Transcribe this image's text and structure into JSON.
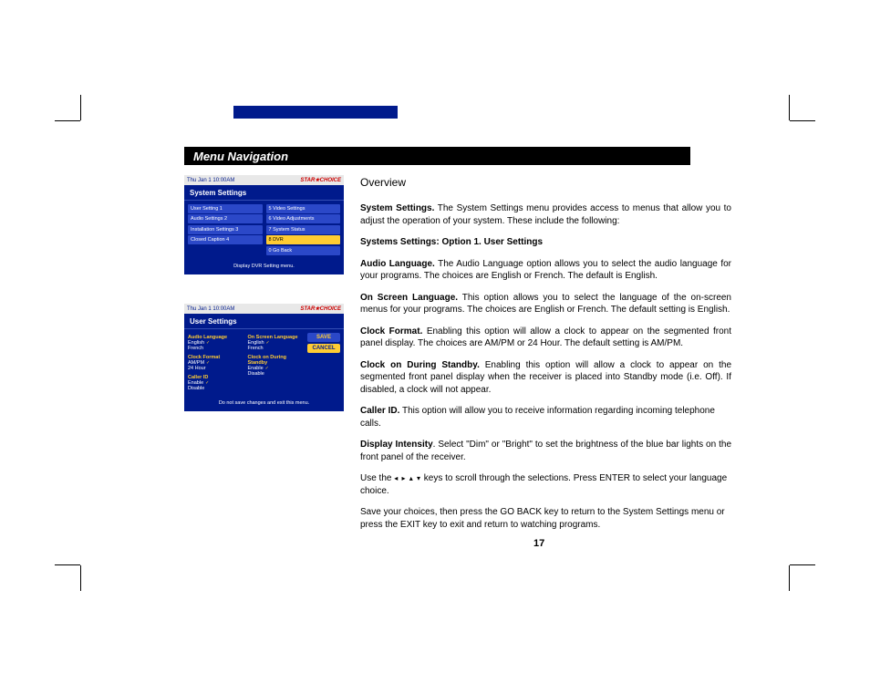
{
  "section_title": "Menu Navigation",
  "overview_heading": "Overview",
  "page_number": "17",
  "body": {
    "p1_bold": "System Settings.",
    "p1": " The System Settings menu provides access to menus that allow you to adjust the operation of your system. These include the following:",
    "p2": "Systems Settings: Option 1. User Settings",
    "p3_bold": "Audio Language.",
    "p3": " The Audio Language option allows you to select the audio language for your programs. The choices are English or French. The default is English.",
    "p4_bold": "On Screen Language.",
    "p4": " This option allows you to select the language of the on-screen menus for your programs. The choices are English or French. The default setting is English.",
    "p5_bold": "Clock Format.",
    "p5": " Enabling this option will allow a clock to appear on the segmented front panel display. The choices are AM/PM or 24 Hour. The default setting is AM/PM.",
    "p6_bold": "Clock on During Standby.",
    "p6": " Enabling this option will allow a clock to appear on the segmented front panel display when the receiver is placed into Standby mode (i.e. Off). If disabled, a clock will not appear.",
    "p7_bold": "Caller ID.",
    "p7": " This option will allow you to receive information regarding incoming telephone calls.",
    "p8_bold": "Display Intensity",
    "p8": ". Select \"Dim\" or \"Bright\" to set the brightness of the blue bar lights on the front panel of the receiver.",
    "p9a": "Use the ",
    "p9_arrows": "◂ ▸ ▴ ▾",
    "p9b": " keys to scroll through the selections. Press ENTER to select your language choice.",
    "p10": "Save your choices, then press the GO BACK key to return to the System Settings menu or press the EXIT key to exit and return to watching programs."
  },
  "shot1": {
    "time": "Thu Jan 1 10:00AM",
    "logo": "STAR★CHOICE",
    "title": "System Settings",
    "left_items": [
      "User Setting 1",
      "Audio Settings 2",
      "Installation Settings 3",
      "Closed Caption 4"
    ],
    "right_items": [
      "5 Video Settings",
      "6 Video Adjustments",
      "7 System Status",
      "8 DVR",
      "0 Go Back"
    ],
    "highlight_index": 3,
    "footer": "Display DVR Setting menu."
  },
  "shot2": {
    "time": "Thu Jan 1 10:00AM",
    "logo": "STAR★CHOICE",
    "title": "User Settings",
    "col1": [
      {
        "label": "Audio Language",
        "opts": [
          "English",
          "French"
        ],
        "checked": 0
      },
      {
        "label": "Clock Format",
        "opts": [
          "AM/PM",
          "24 Hour"
        ],
        "checked": 0
      },
      {
        "label": "Caller ID",
        "opts": [
          "Enable",
          "Disable"
        ],
        "checked": 0
      }
    ],
    "col2": [
      {
        "label": "On Screen Language",
        "opts": [
          "English",
          "French"
        ],
        "checked": 0
      },
      {
        "label": "Clock on During Standby",
        "opts": [
          "Enable",
          "Disable"
        ],
        "checked": 0
      }
    ],
    "save": "SAVE",
    "cancel": "CANCEL",
    "footer": "Do not save changes and exit this menu."
  }
}
